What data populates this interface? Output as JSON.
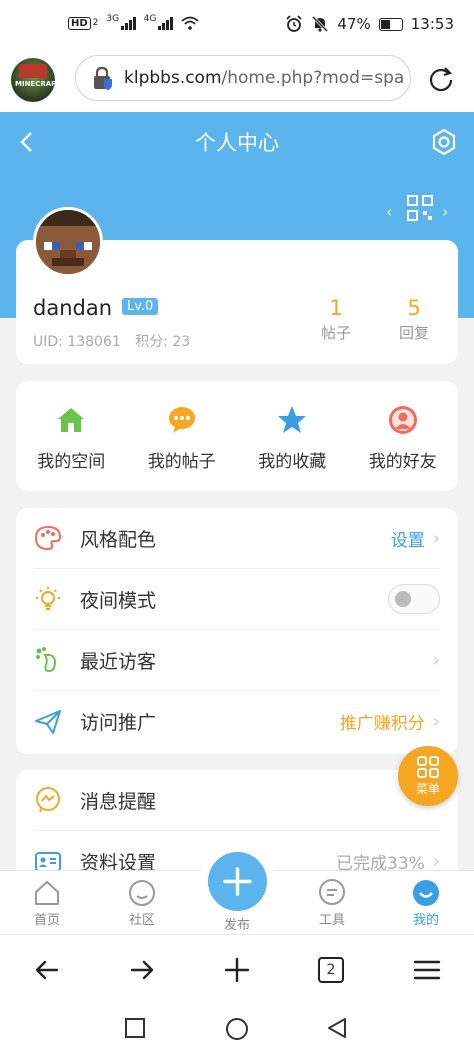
{
  "status_bar": {
    "network_badge": "HD",
    "network_sub": "2",
    "sig1_label": "3G",
    "sig2_label": "4G",
    "battery": "47%",
    "time": "13:53"
  },
  "browser": {
    "url_host": "klpbbs.com",
    "url_path": "/home.php?mod=spa",
    "site_logo_text": "MINECRAFT",
    "tab_count": "2"
  },
  "header": {
    "title": "个人中心"
  },
  "profile": {
    "username": "dandan",
    "level": "Lv.0",
    "uid_text": "UID: 138061",
    "points_text": "积分: 23",
    "stats": [
      {
        "value": "1",
        "label": "帖子"
      },
      {
        "value": "5",
        "label": "回复"
      }
    ]
  },
  "quick_actions": [
    {
      "label": "我的空间",
      "icon": "home-icon",
      "color": "#6cc24a"
    },
    {
      "label": "我的帖子",
      "icon": "chat-bubble-icon",
      "color": "#f5a623"
    },
    {
      "label": "我的收藏",
      "icon": "star-icon",
      "color": "#3a9ee4"
    },
    {
      "label": "我的好友",
      "icon": "friend-icon",
      "color": "#f26b5b"
    }
  ],
  "menu": [
    {
      "label": "风格配色",
      "icon": "palette-icon",
      "right": "设置",
      "right_color": "#3a9ee4"
    },
    {
      "label": "夜间模式",
      "icon": "bulb-icon",
      "toggle": false
    },
    {
      "label": "最近访客",
      "icon": "footprint-icon",
      "right": ""
    },
    {
      "label": "访问推广",
      "icon": "paper-plane-icon",
      "right": "推广赚积分",
      "right_color": "#f5a623"
    }
  ],
  "menu2": [
    {
      "label": "消息提醒",
      "icon": "messenger-icon",
      "right": ""
    },
    {
      "label": "资料设置",
      "icon": "profile-card-icon",
      "right": "已完成33%"
    }
  ],
  "fab": {
    "label": "菜单"
  },
  "tabbar": [
    {
      "label": "首页",
      "icon": "home-outline-icon"
    },
    {
      "label": "社区",
      "icon": "community-icon"
    },
    {
      "label": "发布",
      "icon": "plus-icon"
    },
    {
      "label": "工具",
      "icon": "tools-icon"
    },
    {
      "label": "我的",
      "icon": "me-icon",
      "active": true
    }
  ],
  "colors": {
    "accent": "#5bb4ec",
    "orange": "#f5a623"
  }
}
